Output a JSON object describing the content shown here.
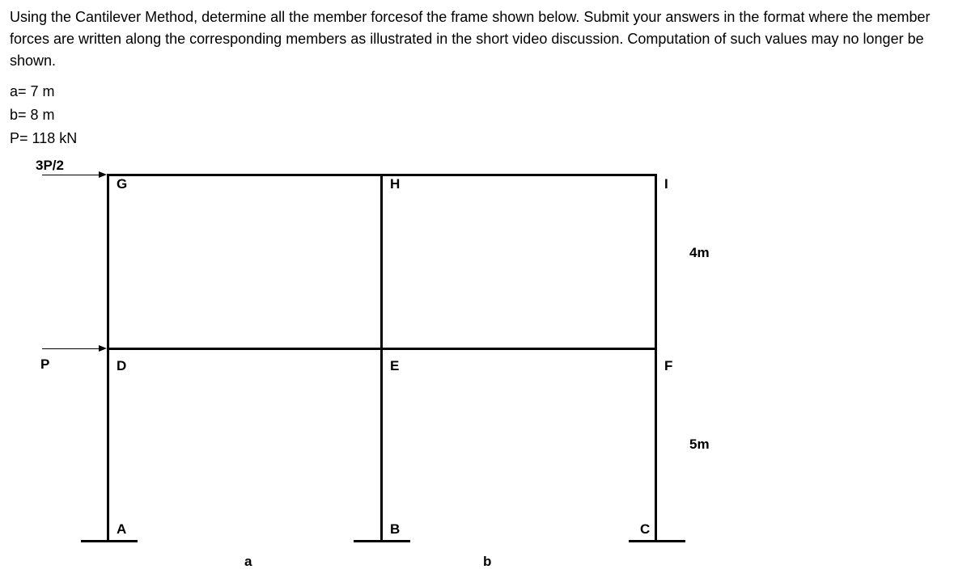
{
  "problem": {
    "text": "Using the Cantilever Method, determine all the member forcesof the frame shown below. Submit your answers in the format where the member forces are written along the corresponding members as illustrated in the short video discussion. Computation of such values may no longer be shown."
  },
  "params": {
    "a": "a= 7 m",
    "b": "b= 8 m",
    "P": "P= 118 kN"
  },
  "diagram": {
    "loads": {
      "top": "3P/2",
      "mid": "P"
    },
    "nodes": {
      "G": "G",
      "H": "H",
      "I": "I",
      "D": "D",
      "E": "E",
      "F": "F",
      "A": "A",
      "B": "B",
      "C": "C"
    },
    "spans": {
      "a": "a",
      "b": "b"
    },
    "heights": {
      "top": "4m",
      "bottom": "5m"
    }
  }
}
